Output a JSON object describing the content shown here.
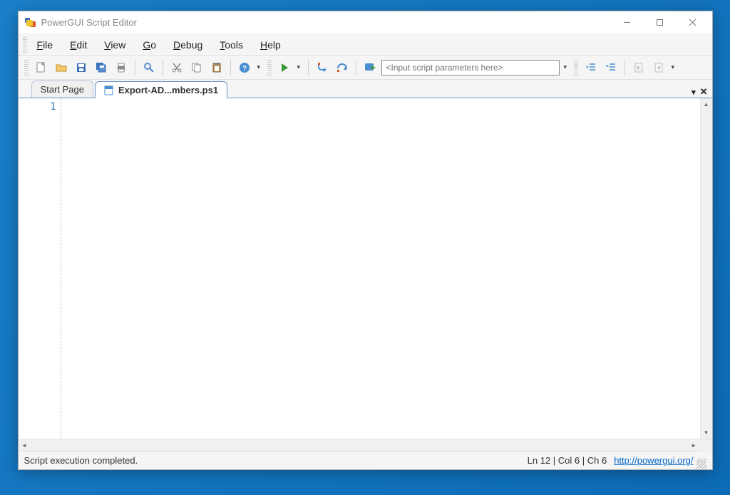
{
  "titlebar": {
    "title": "PowerGUI Script Editor"
  },
  "menu": {
    "file": "File",
    "edit": "Edit",
    "view": "View",
    "go": "Go",
    "debug": "Debug",
    "tools": "Tools",
    "help": "Help"
  },
  "toolbar": {
    "params_placeholder": "<Input script parameters here>"
  },
  "tabs": {
    "start": "Start Page",
    "file1": "Export-AD...mbers.ps1"
  },
  "editor": {
    "line1": "1",
    "content": ""
  },
  "status": {
    "message": "Script execution completed.",
    "position": "Ln 12 | Col 6 | Ch 6",
    "link": "http://powergui.org/"
  }
}
